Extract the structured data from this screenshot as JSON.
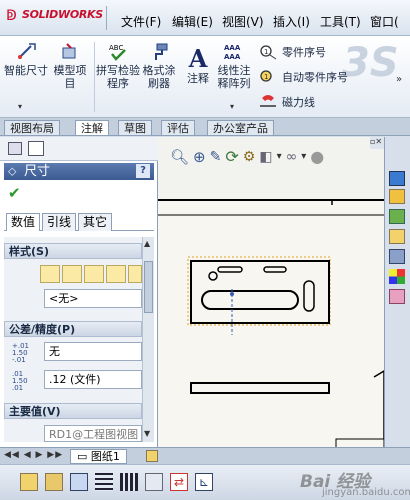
{
  "app": {
    "brand": "SOLIDWORKS"
  },
  "menu": [
    "文件(F)",
    "编辑(E)",
    "视图(V)",
    "插入(I)",
    "工具(T)",
    "窗口("
  ],
  "ribbon": {
    "smart_dim": "智能尺寸",
    "model_items": "模型项目",
    "spell_check": "拼写检验程序",
    "format_painter": "格式涂刷器",
    "note": "注释",
    "linear_note_array": "线性注释阵列",
    "balloon": "零件序号",
    "auto_balloon": "自动零件序号",
    "magnetic_line": "磁力线"
  },
  "tabs": [
    "视图布局",
    "注解",
    "草图",
    "评估",
    "办公室产品"
  ],
  "active_tab": "注解",
  "property_manager": {
    "title": "尺寸",
    "help": "?",
    "subtabs": [
      "数值",
      "引线",
      "其它"
    ],
    "style_section": "样式(S)",
    "style_value": "<无>",
    "tolerance_section": "公差/精度(P)",
    "tolerance_value": "无",
    "precision_value": ".12 (文件)",
    "primary_section": "主要值(V)",
    "primary_value": "RD1@工程图视图"
  },
  "sheet_tab": "图纸1",
  "watermark": {
    "main": "Bai 经验",
    "sub": "jingyan.baidu.com"
  }
}
